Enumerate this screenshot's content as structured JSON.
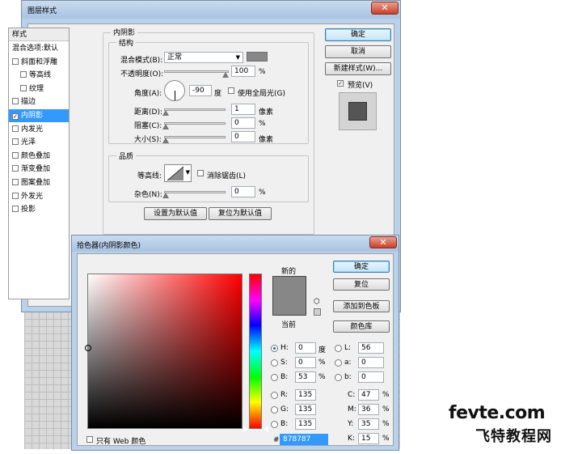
{
  "layer_style": {
    "title": "图层样式",
    "list_header": "样式",
    "list_items": [
      {
        "label": "混合选项:默认",
        "checkbox": false,
        "checked": false,
        "selected": false,
        "indent": false
      },
      {
        "label": "斜面和浮雕",
        "checkbox": true,
        "checked": false,
        "selected": false,
        "indent": false
      },
      {
        "label": "等高线",
        "checkbox": true,
        "checked": false,
        "selected": false,
        "indent": true
      },
      {
        "label": "纹理",
        "checkbox": true,
        "checked": false,
        "selected": false,
        "indent": true
      },
      {
        "label": "描边",
        "checkbox": true,
        "checked": false,
        "selected": false,
        "indent": false
      },
      {
        "label": "内阴影",
        "checkbox": true,
        "checked": true,
        "selected": true,
        "indent": false
      },
      {
        "label": "内发光",
        "checkbox": true,
        "checked": false,
        "selected": false,
        "indent": false
      },
      {
        "label": "光泽",
        "checkbox": true,
        "checked": false,
        "selected": false,
        "indent": false
      },
      {
        "label": "颜色叠加",
        "checkbox": true,
        "checked": false,
        "selected": false,
        "indent": false
      },
      {
        "label": "渐变叠加",
        "checkbox": true,
        "checked": false,
        "selected": false,
        "indent": false
      },
      {
        "label": "图案叠加",
        "checkbox": true,
        "checked": false,
        "selected": false,
        "indent": false
      },
      {
        "label": "外发光",
        "checkbox": true,
        "checked": false,
        "selected": false,
        "indent": false
      },
      {
        "label": "投影",
        "checkbox": true,
        "checked": false,
        "selected": false,
        "indent": false
      }
    ],
    "section_title": "内阴影",
    "structure_title": "结构",
    "blend_mode_label": "混合模式(B):",
    "blend_mode_value": "正常",
    "opacity_label": "不透明度(O):",
    "opacity_value": "100",
    "opacity_unit": "%",
    "angle_label": "角度(A):",
    "angle_value": "-90",
    "angle_unit": "度",
    "global_light_label": "使用全局光(G)",
    "distance_label": "距离(D):",
    "distance_value": "1",
    "distance_unit": "像素",
    "choke_label": "阻塞(C):",
    "choke_value": "0",
    "choke_unit": "%",
    "size_label": "大小(S):",
    "size_value": "0",
    "size_unit": "像素",
    "quality_title": "品质",
    "contour_label": "等高线:",
    "antialias_label": "消除锯齿(L)",
    "noise_label": "杂色(N):",
    "noise_value": "0",
    "noise_unit": "%",
    "set_default_btn": "设置为默认值",
    "reset_default_btn": "复位为默认值",
    "ok_btn": "确定",
    "cancel_btn": "取消",
    "new_style_btn": "新建样式(W)...",
    "preview_label": "预览(V)",
    "close_symbol": "✕"
  },
  "color_picker": {
    "title": "拾色器(内阴影颜色)",
    "new_label": "新的",
    "current_label": "当前",
    "ok_btn": "确定",
    "reset_btn": "复位",
    "add_swatch_btn": "添加到色板",
    "libraries_btn": "颜色库",
    "web_only_label": "只有 Web 颜色",
    "fields_left": [
      {
        "label": "H:",
        "value": "0",
        "unit": "度",
        "selected": true
      },
      {
        "label": "S:",
        "value": "0",
        "unit": "%",
        "selected": false
      },
      {
        "label": "B:",
        "value": "53",
        "unit": "%",
        "selected": false
      },
      {
        "label": "R:",
        "value": "135",
        "unit": "",
        "selected": false
      },
      {
        "label": "G:",
        "value": "135",
        "unit": "",
        "selected": false
      },
      {
        "label": "B:",
        "value": "135",
        "unit": "",
        "selected": false
      }
    ],
    "fields_lab": [
      {
        "label": "L:",
        "value": "56"
      },
      {
        "label": "a:",
        "value": "0"
      },
      {
        "label": "b:",
        "value": "0"
      }
    ],
    "fields_cmyk": [
      {
        "label": "C:",
        "value": "47",
        "unit": "%"
      },
      {
        "label": "M:",
        "value": "36",
        "unit": "%"
      },
      {
        "label": "Y:",
        "value": "35",
        "unit": "%"
      },
      {
        "label": "K:",
        "value": "15",
        "unit": "%"
      }
    ],
    "hex_label": "#",
    "hex_value": "878787",
    "close_symbol": "✕"
  },
  "colors": {
    "shadow_color": "#878787",
    "preview_swatch": "#555555"
  },
  "watermark": {
    "line1": "fevte.com",
    "line2": "飞特教程网"
  }
}
